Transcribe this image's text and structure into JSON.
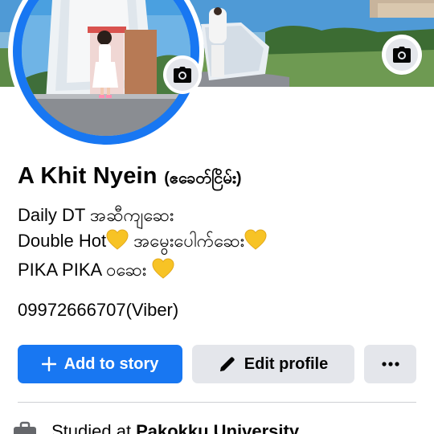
{
  "profile": {
    "name": "A Khit Nyein",
    "alternate_name": "(ဧခေတ်ငြိမ်း)",
    "bio": [
      {
        "text": "Daily DT အဆီကျဆေး",
        "emoji": ""
      },
      {
        "text": "Double Hot",
        "emoji": "yellow-heart",
        "suffix": " အမွေးပေါက်ဆေး"
      },
      {
        "text": "PIKA PIKA ၀ဆေး ",
        "emoji": "yellow-heart",
        "suffix": ""
      }
    ],
    "phone": "09972666707(Viber)"
  },
  "actions": {
    "add_story_label": "Add to story",
    "edit_profile_label": "Edit profile",
    "more_label": "···"
  },
  "details": {
    "studied_prefix": "Studied at",
    "studied_school": "Pakokku University"
  },
  "icons": {
    "cover_camera": "camera-icon",
    "avatar_camera": "camera-icon",
    "add": "plus-icon",
    "edit": "pencil-icon",
    "study": "briefcase-icon"
  },
  "colors": {
    "accent": "#1877f2",
    "secondary_button": "#e4e6eb",
    "heart": "#f7c325"
  }
}
